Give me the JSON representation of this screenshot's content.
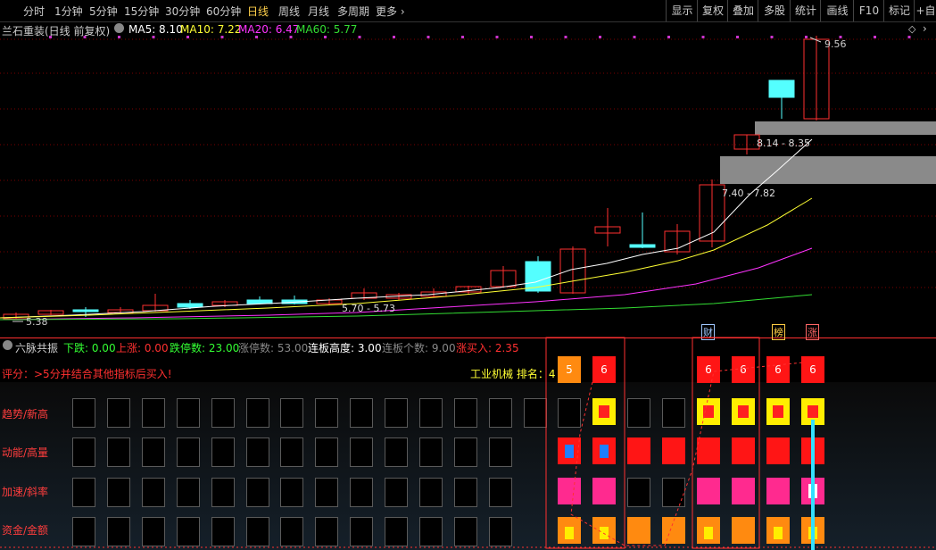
{
  "toolbar": {
    "periods": [
      "分时",
      "1分钟",
      "5分钟",
      "15分钟",
      "30分钟",
      "60分钟",
      "日线",
      "周线",
      "月线",
      "多周期",
      "更多"
    ],
    "active_period": "日线",
    "more_arrow": "›",
    "buttons": [
      "显示",
      "复权",
      "叠加",
      "多股",
      "统计",
      "画线",
      "F10",
      "标记",
      "+自"
    ]
  },
  "main_chart": {
    "title": "兰石重装(日线 前复权)",
    "ma": [
      {
        "label": "MA5: 8.10",
        "color": "#ffffff"
      },
      {
        "label": "MA10: 7.22",
        "color": "#ffff33"
      },
      {
        "label": "MA20: 6.47",
        "color": "#ff33ff"
      },
      {
        "label": "MA60: 5.77",
        "color": "#33dd33"
      }
    ],
    "high_label": "9.56",
    "low_label": "5.38",
    "zone_labels": [
      "8.14 - 8.35",
      "7.40 - 7.82",
      "5.70 - 5.73"
    ],
    "colors": {
      "up": "#ff3030",
      "down": "#54ffff",
      "grid": "#7a0000"
    }
  },
  "indicator": {
    "title": "六脉共振",
    "stats": [
      {
        "label": "下跌: 0.00",
        "color": "#33ff33"
      },
      {
        "label": "上涨: 0.00",
        "color": "#ff3030"
      },
      {
        "label": "跌停数: 23.00",
        "color": "#33ff33"
      },
      {
        "label": "涨停数: 53.00",
        "color": "#888888"
      },
      {
        "label": "连板高度: 3.00",
        "color": "#ffffff"
      },
      {
        "label": "连板个数: 9.00",
        "color": "#888888"
      },
      {
        "label": "涨买入: 2.35",
        "color": "#ff3030"
      }
    ],
    "score_text": "评分：>5分并结合其他指标后买入!",
    "industry_text": "工业机械 排名：4",
    "badges": [
      "财",
      "榜",
      "涨"
    ],
    "rows": [
      "趋势/新高",
      "动能/高量",
      "加速/斜率",
      "资金/金额"
    ],
    "scores": [
      "5",
      "6",
      "6",
      "6",
      "6",
      "6"
    ]
  }
}
